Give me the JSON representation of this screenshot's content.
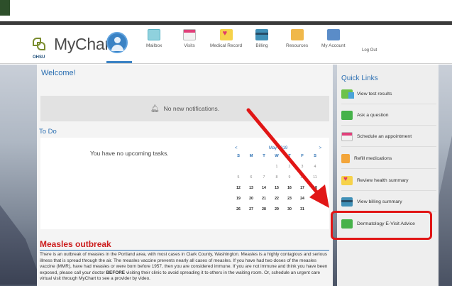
{
  "app": {
    "logo_text": "MyChart",
    "org": "OHSU"
  },
  "nav": [
    {
      "label": "Mailbox",
      "icon": "mailbox-icon"
    },
    {
      "label": "Visits",
      "icon": "calendar-icon"
    },
    {
      "label": "Medical Record",
      "icon": "heart-folder-icon"
    },
    {
      "label": "Billing",
      "icon": "credit-card-icon"
    },
    {
      "label": "Resources",
      "icon": "book-icon"
    },
    {
      "label": "My Account",
      "icon": "id-card-icon"
    }
  ],
  "logout_label": "Log Out",
  "main": {
    "welcome": "Welcome!",
    "notifications_text": "No new notifications.",
    "todo_title": "To Do",
    "no_tasks": "You have no upcoming tasks."
  },
  "calendar": {
    "prev": "<",
    "next": ">",
    "month": "May 2019",
    "days_of_week": [
      "S",
      "M",
      "T",
      "W",
      "T",
      "F",
      "S"
    ],
    "rows": [
      [
        "",
        "",
        "",
        "1",
        "2",
        "3",
        "4"
      ],
      [
        "5",
        "6",
        "7",
        "8",
        "9",
        "10",
        "11"
      ],
      [
        "12",
        "13",
        "14",
        "15",
        "16",
        "17",
        "18"
      ],
      [
        "19",
        "20",
        "21",
        "22",
        "23",
        "24",
        "25"
      ],
      [
        "26",
        "27",
        "28",
        "29",
        "30",
        "31",
        ""
      ]
    ]
  },
  "measles": {
    "title": "Measles outbreak",
    "body_1": "There is an outbreak of measles in the Portland area, with most cases in Clark County, Washington. Measles is a highly contagious and serious illness that is spread through the air. The measles vaccine prevents nearly all cases of measles. If you have had two doses of the measles vaccine (MMR), have had measles or were born before 1957, then you are considered immune. If you are not immune and think you have been exposed, please call your doctor ",
    "body_bold": "BEFORE",
    "body_2": " visiting their clinic to avoid spreading it to others in the waiting room. Or, schedule an urgent care virtual visit through MyChart to see a provider by video."
  },
  "quick_links": {
    "title": "Quick Links",
    "items": [
      {
        "label": "View test results",
        "icon": "test-results-icon"
      },
      {
        "label": "Ask a question",
        "icon": "chat-bubble-icon"
      },
      {
        "label": "Schedule an appointment",
        "icon": "calendar-icon"
      },
      {
        "label": "Refill medications",
        "icon": "pill-bottle-icon"
      },
      {
        "label": "Review health summary",
        "icon": "heart-folder-icon"
      },
      {
        "label": "View billing summary",
        "icon": "credit-card-icon"
      },
      {
        "label": "Dermatology E-Visit Advice",
        "icon": "chat-bubble-icon"
      }
    ]
  },
  "colors": {
    "accent": "#2b6fb2",
    "alert": "#cc1d1d",
    "highlight": "#e11616"
  }
}
